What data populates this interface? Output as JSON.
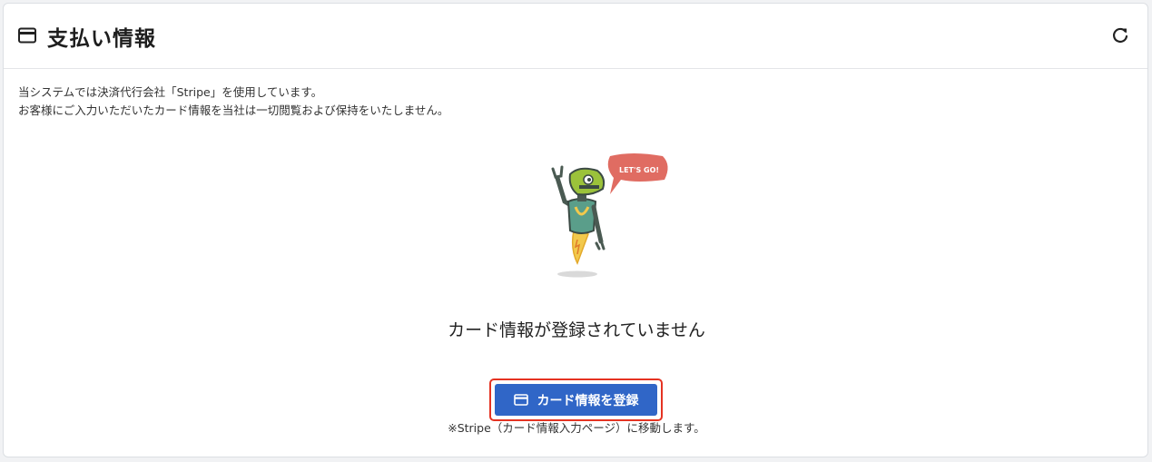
{
  "header": {
    "title": "支払い情報",
    "icon": "credit-card-icon",
    "refresh_icon": "refresh-icon"
  },
  "description": {
    "line1": "当システムでは決済代行会社「Stripe」を使用しています。",
    "line2": "お客様にご入力いただいたカード情報を当社は一切閲覧および保持をいたしません。"
  },
  "illustration": {
    "speech_text": "LET'S GO!"
  },
  "empty_state": {
    "message": "カード情報が登録されていません"
  },
  "actions": {
    "register_label": "カード情報を登録",
    "register_icon": "credit-card-icon",
    "button_color": "#3066c7",
    "highlight_color": "#e53322"
  },
  "note": "※Stripe（カード情報入力ページ）に移動します。"
}
